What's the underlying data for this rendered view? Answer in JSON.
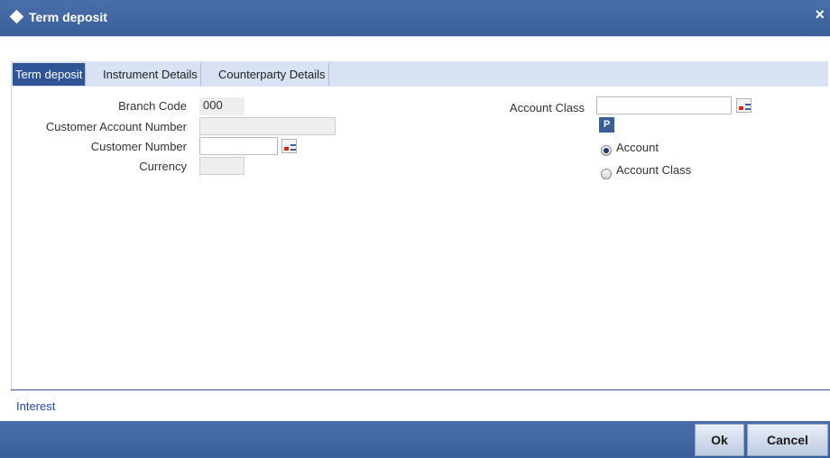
{
  "window": {
    "title": "Term deposit",
    "close_glyph": "×"
  },
  "tabs": [
    {
      "label": "Term deposit",
      "active": true
    },
    {
      "label": "Instrument Details",
      "active": false
    },
    {
      "label": "Counterparty Details",
      "active": false
    }
  ],
  "form": {
    "branch_code": {
      "label": "Branch Code",
      "value": "000"
    },
    "customer_account_number": {
      "label": "Customer Account Number",
      "value": ""
    },
    "customer_number": {
      "label": "Customer Number",
      "value": ""
    },
    "currency": {
      "label": "Currency",
      "value": ""
    },
    "account_class": {
      "label": "Account Class",
      "value": ""
    },
    "p_button_label": "P",
    "radio_options": [
      {
        "label": "Account",
        "checked": true
      },
      {
        "label": "Account Class",
        "checked": false
      }
    ]
  },
  "links": {
    "interest": "Interest"
  },
  "footer": {
    "ok_label": "Ok",
    "cancel_label": "Cancel"
  },
  "colors": {
    "header_blue": "#3a5f98",
    "active_tab": "#2f5597",
    "tabstrip": "#d8e2f2",
    "link": "#2447a3"
  }
}
